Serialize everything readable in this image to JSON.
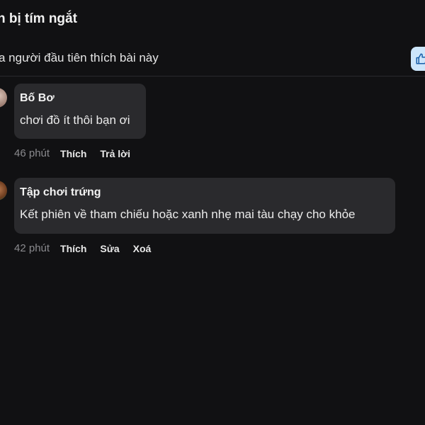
{
  "post": {
    "title": "n bị tím ngắt",
    "likes_text": "a người đầu tiên thích bài này"
  },
  "comments": [
    {
      "author": "Bố Bơ",
      "text": "chơi đồ ít thôi bạn ơi",
      "time": "46 phút",
      "actions": [
        "Thích",
        "Trả lời"
      ]
    },
    {
      "author": "Tập chơi trứng",
      "text": "Kết phiên về tham chiếu hoặc xanh nhẹ mai tàu chạy cho khỏe",
      "time": "42 phút",
      "actions": [
        "Thích",
        "Sửa",
        "Xoá"
      ]
    }
  ],
  "icons": {
    "like_toggle": "thumbs-up-icon"
  },
  "colors": {
    "background": "#111113",
    "bubble": "#2a2a2d",
    "like_toggle_bg": "#cde6fb",
    "like_icon": "#1a5fa8"
  }
}
